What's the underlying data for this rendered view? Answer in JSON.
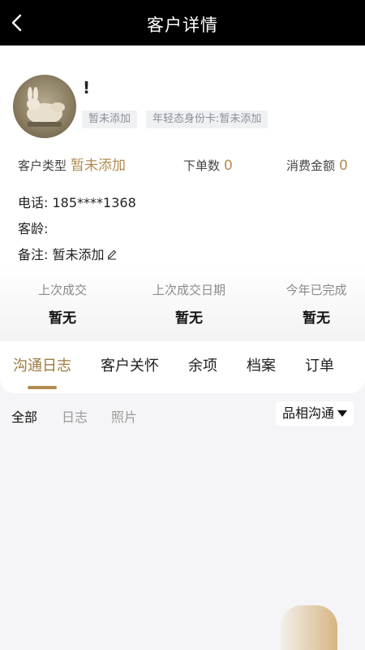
{
  "nav": {
    "title": "客户详情",
    "back_icon": "chevron-left-icon"
  },
  "customer": {
    "name": "!",
    "tags": [
      "暂未添加",
      "年轻态身份卡:暂未添加"
    ],
    "type_label": "客户类型",
    "type_value": "暂未添加",
    "orders_label": "下单数",
    "orders_value": "0",
    "spend_label": "消费金额",
    "spend_value": "0",
    "phone_label": "电话:",
    "phone_value": "185****1368",
    "age_label": "客龄:",
    "age_value": "",
    "note_label": "备注:",
    "note_value": "暂未添加"
  },
  "stats": [
    {
      "label": "上次成交",
      "value": "暂无"
    },
    {
      "label": "上次成交日期",
      "value": "暂无"
    },
    {
      "label": "今年已完成",
      "value": "暂无"
    }
  ],
  "tabs": [
    {
      "label": "沟通日志",
      "active": true
    },
    {
      "label": "客户关怀",
      "active": false
    },
    {
      "label": "余项",
      "active": false
    },
    {
      "label": "档案",
      "active": false
    },
    {
      "label": "订单",
      "active": false
    }
  ],
  "filters": {
    "items": [
      "全部",
      "日志",
      "照片"
    ],
    "dropdown": "品相沟通"
  },
  "colors": {
    "accent": "#b38b4f",
    "nav_bg": "#000000"
  }
}
